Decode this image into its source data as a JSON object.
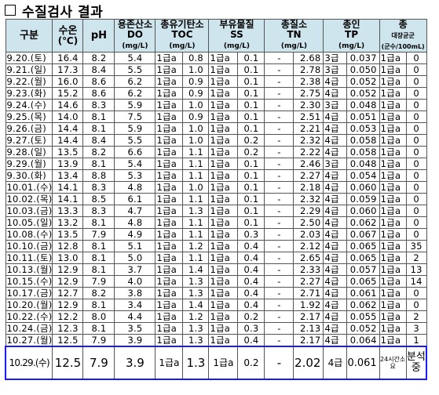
{
  "title": "수질검사 결과",
  "headers": {
    "date": "구분",
    "temp": "수온",
    "temp_unit": "(℃)",
    "ph": "pH",
    "do_name": "용존산소",
    "do_abbr": "DO",
    "do_unit": "(mg/L)",
    "toc_name": "총유기탄소",
    "toc_abbr": "TOC",
    "toc_unit": "(mg/L)",
    "ss_name": "부유물질",
    "ss_abbr": "SS",
    "ss_unit": "(mg/L)",
    "tn_name": "총질소",
    "tn_abbr": "TN",
    "tn_unit": "(mg/L)",
    "tp_name": "총인",
    "tp_abbr": "TP",
    "tp_unit": "(mg/L)",
    "bac_name": "총",
    "bac_sub": "대장균군",
    "bac_unit": "(군수/100mL)"
  },
  "rows": [
    [
      "9.20.(토)",
      "16.4",
      "8.2",
      "5.4",
      "1급a",
      "0.8",
      "1급a",
      "0.1",
      "-",
      "2.68",
      "3급",
      "0.037",
      "1급a",
      "0"
    ],
    [
      "9.21.(일)",
      "17.3",
      "8.4",
      "5.5",
      "1급a",
      "1.0",
      "1급a",
      "0.1",
      "-",
      "2.78",
      "3급",
      "0.050",
      "1급a",
      "0"
    ],
    [
      "9.22.(월)",
      "16.0",
      "8.6",
      "6.2",
      "1급a",
      "0.9",
      "1급a",
      "0.1",
      "-",
      "2.38",
      "4급",
      "0.052",
      "1급a",
      "0"
    ],
    [
      "9.23.(화)",
      "15.2",
      "8.6",
      "6.2",
      "1급a",
      "0.9",
      "1급a",
      "0.1",
      "-",
      "2.75",
      "4급",
      "0.052",
      "1급a",
      "0"
    ],
    [
      "9.24.(수)",
      "14.6",
      "8.3",
      "5.9",
      "1급a",
      "1.0",
      "1급a",
      "0.1",
      "-",
      "2.30",
      "3급",
      "0.048",
      "1급a",
      "0"
    ],
    [
      "9.25.(목)",
      "14.0",
      "8.1",
      "7.5",
      "1급a",
      "0.9",
      "1급a",
      "0.1",
      "-",
      "2.51",
      "4급",
      "0.051",
      "1급a",
      "0"
    ],
    [
      "9.26.(금)",
      "14.4",
      "8.1",
      "5.9",
      "1급a",
      "1.0",
      "1급a",
      "0.1",
      "-",
      "2.21",
      "4급",
      "0.053",
      "1급a",
      "0"
    ],
    [
      "9.27.(토)",
      "14.4",
      "8.4",
      "5.5",
      "1급a",
      "1.0",
      "1급a",
      "0.2",
      "-",
      "2.32",
      "4급",
      "0.058",
      "1급a",
      "0"
    ],
    [
      "9.28.(일)",
      "13.5",
      "8.2",
      "6.6",
      "1급a",
      "1.1",
      "1급a",
      "0.2",
      "-",
      "2.22",
      "4급",
      "0.058",
      "1급a",
      "0"
    ],
    [
      "9.29.(월)",
      "13.9",
      "8.1",
      "5.4",
      "1급a",
      "1.1",
      "1급a",
      "0.1",
      "-",
      "2.46",
      "3급",
      "0.048",
      "1급a",
      "0"
    ],
    [
      "9.30.(화)",
      "13.4",
      "8.8",
      "5.3",
      "1급a",
      "1.1",
      "1급a",
      "0.1",
      "-",
      "2.27",
      "4급",
      "0.054",
      "1급a",
      "0"
    ],
    [
      "10.01.(수)",
      "14.1",
      "8.3",
      "4.8",
      "1급a",
      "1.0",
      "1급a",
      "0.1",
      "-",
      "2.18",
      "4급",
      "0.060",
      "1급a",
      "0"
    ],
    [
      "10.02.(목)",
      "14.1",
      "8.5",
      "6.1",
      "1급a",
      "1.1",
      "1급a",
      "0.1",
      "-",
      "2.32",
      "4급",
      "0.059",
      "1급a",
      "0"
    ],
    [
      "10.03.(금)",
      "13.3",
      "8.3",
      "4.7",
      "1급a",
      "1.3",
      "1급a",
      "0.1",
      "-",
      "2.29",
      "4급",
      "0.060",
      "1급a",
      "0"
    ],
    [
      "10.05.(일)",
      "13.2",
      "8.1",
      "4.8",
      "1급a",
      "1.1",
      "1급a",
      "0.1",
      "-",
      "2.50",
      "4급",
      "0.062",
      "1급a",
      "0"
    ],
    [
      "10.08.(수)",
      "13.5",
      "7.9",
      "4.9",
      "1급a",
      "1.1",
      "1급a",
      "0.3",
      "-",
      "2.03",
      "4급",
      "0.067",
      "1급a",
      "0"
    ],
    [
      "10.10.(금)",
      "12.8",
      "8.1",
      "5.1",
      "1급a",
      "1.2",
      "1급a",
      "0.4",
      "-",
      "2.12",
      "4급",
      "0.065",
      "1급a",
      "35"
    ],
    [
      "10.11.(토)",
      "13.0",
      "8.1",
      "5.0",
      "1급a",
      "1.1",
      "1급a",
      "0.4",
      "-",
      "2.65",
      "4급",
      "0.065",
      "1급a",
      "2"
    ],
    [
      "10.13.(월)",
      "12.9",
      "8.1",
      "3.7",
      "1급a",
      "1.4",
      "1급a",
      "0.4",
      "-",
      "2.33",
      "4급",
      "0.057",
      "1급a",
      "13"
    ],
    [
      "10.15.(수)",
      "12.9",
      "7.9",
      "4.0",
      "1급a",
      "1.3",
      "1급a",
      "0.4",
      "-",
      "2.27",
      "4급",
      "0.065",
      "1급a",
      "14"
    ],
    [
      "10.17.(금)",
      "12.7",
      "8.2",
      "3.8",
      "1급a",
      "1.3",
      "1급a",
      "0.4",
      "-",
      "2.71",
      "4급",
      "0.061",
      "1급a",
      "0"
    ],
    [
      "10.20.(월)",
      "12.9",
      "8.1",
      "3.4",
      "1급a",
      "1.4",
      "1급a",
      "0.4",
      "-",
      "1.92",
      "4급",
      "0.062",
      "1급a",
      "0"
    ],
    [
      "10.22.(수)",
      "12.2",
      "8.0",
      "4.4",
      "1급a",
      "1.2",
      "1급a",
      "0.2",
      "-",
      "2.17",
      "4급",
      "0.055",
      "1급a",
      "2"
    ],
    [
      "10.24.(금)",
      "12.3",
      "8.1",
      "3.5",
      "1급a",
      "1.3",
      "1급a",
      "0.3",
      "-",
      "2.13",
      "4급",
      "0.052",
      "1급a",
      "3"
    ],
    [
      "10.27.(월)",
      "12.5",
      "7.9",
      "3.9",
      "1급a",
      "1.3",
      "1급a",
      "0.4",
      "-",
      "2.17",
      "4급",
      "0.064",
      "1급a",
      "1"
    ]
  ],
  "last_row": {
    "date": "10.29.(수)",
    "temp": "12.5",
    "ph": "7.9",
    "do": "3.9",
    "toc_grade": "1급a",
    "toc": "1.3",
    "ss_grade": "1급a",
    "ss": "0.2",
    "tn_grade": "-",
    "tn": "2.02",
    "tp_grade": "4급",
    "tp": "0.061",
    "bac_grade": "24시간소요",
    "bac": "분석중"
  },
  "colors": {
    "header_bg": "#cfe5ee",
    "highlight_border": "#1a1aff"
  }
}
